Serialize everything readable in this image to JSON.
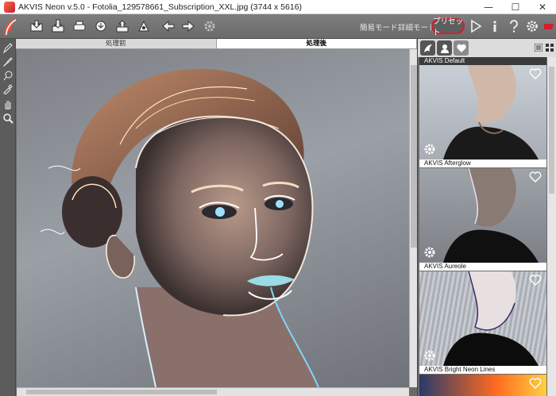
{
  "window": {
    "title": "AKVIS Neon v.5.0 - Fotolia_129578661_Subscription_XXL.jpg (3744 x 5616)",
    "minimize": "—",
    "maximize": "☐",
    "close": "✕"
  },
  "toolbar": {
    "simple_mode": "簡易モード",
    "advanced_mode": "詳細モード",
    "presets": "プリセット",
    "icons": [
      "open-icon",
      "save-icon",
      "print-icon",
      "share-icon",
      "upload-icon",
      "batch-icon",
      "undo-arrow-icon",
      "redo-arrow-icon",
      "settings-gear-icon",
      "run-icon",
      "info-icon",
      "help-icon",
      "preferences-icon",
      "stop-icon"
    ]
  },
  "tabs": {
    "before": "処理前",
    "after": "処理後"
  },
  "presets": {
    "default_label": "AKVIS Default",
    "items": [
      {
        "label": "AKVIS Afterglow"
      },
      {
        "label": "AKVIS Aureole"
      },
      {
        "label": "AKVIS Bright Neon Lines"
      }
    ]
  },
  "colors": {
    "accent_red": "#d2202a",
    "toolbar_bg": "#707070",
    "panel_bg": "#6b6b6b"
  }
}
